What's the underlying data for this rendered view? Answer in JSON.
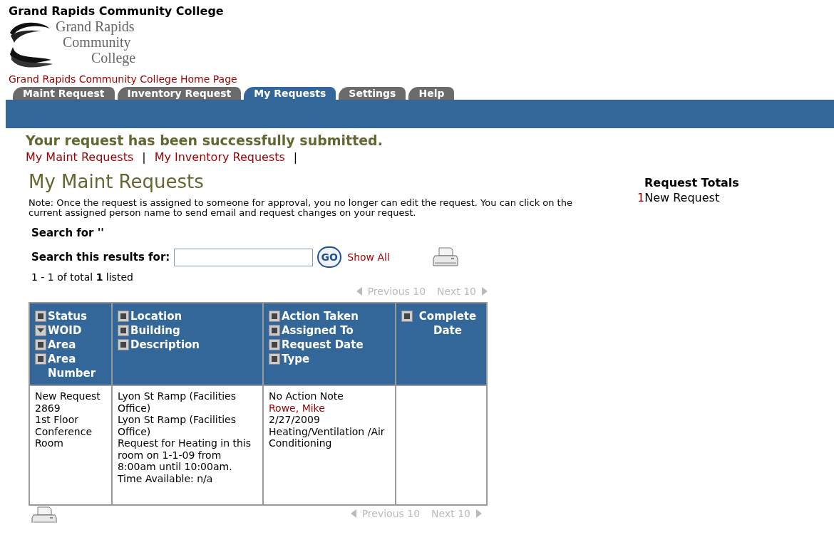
{
  "site_title": "Grand Rapids Community College",
  "logo_text": [
    "Grand Rapids",
    "Community",
    "College"
  ],
  "home_link": "Grand Rapids Community College Home Page",
  "tabs": [
    {
      "label": "Maint Request",
      "selected": false
    },
    {
      "label": "Inventory Request",
      "selected": false
    },
    {
      "label": "My Requests",
      "selected": true
    },
    {
      "label": "Settings",
      "selected": false
    },
    {
      "label": "Help",
      "selected": false
    }
  ],
  "success_message": "Your request has been successfully submitted.",
  "sub_links": [
    {
      "label": "My Maint Requests",
      "separator": "|"
    },
    {
      "label": "My Inventory Requests",
      "separator": "|"
    }
  ],
  "page_heading": "My Maint Requests",
  "note": "Note: Once the request is assigned to someone for approval, you no longer can edit the request. You can click on the current assigned person name to send email and request changes on your request.",
  "search_for": "Search for ''",
  "search_label": "Search this results for:",
  "go_button": "GO",
  "show_all": "Show All",
  "listed": "1 - 1 of total **1** listed",
  "pager_top": {
    "previous": "Previous 10",
    "next": "Next 10"
  },
  "pager_bottom": {
    "previous": "Previous 10",
    "next": "Next 10"
  },
  "table": {
    "columns": [
      {
        "fields": [
          {
            "label": "Status",
            "sorted": false
          },
          {
            "label": "WOID",
            "sorted": true
          },
          {
            "label": "Area",
            "sorted": false
          },
          {
            "label": "Area Number",
            "sorted": false
          }
        ]
      },
      {
        "fields": [
          {
            "label": "Location",
            "sorted": false
          },
          {
            "label": "Building",
            "sorted": false
          },
          {
            "label": "Description",
            "sorted": false
          }
        ]
      },
      {
        "fields": [
          {
            "label": "Action Taken",
            "sorted": false
          },
          {
            "label": "Assigned To",
            "sorted": false
          },
          {
            "label": "Request Date",
            "sorted": false
          },
          {
            "label": "Type",
            "sorted": false
          }
        ]
      },
      {
        "fields": [
          {
            "label": "Complete Date",
            "sorted": false
          }
        ]
      }
    ],
    "rows": [
      [
        [
          {
            "kind": "text",
            "text": "New Request"
          },
          {
            "kind": "text",
            "text": "2869"
          },
          {
            "kind": "text",
            "text": "1st Floor Conference Room"
          }
        ],
        [
          {
            "kind": "text",
            "text": "Lyon St Ramp (Facilities Office)"
          },
          {
            "kind": "text",
            "text": "Lyon St Ramp (Facilities Office)"
          },
          {
            "kind": "text",
            "text": "Request for Heating in this room on 1-1-09 from 8:00am until 10:00am. Time Available: n/a"
          }
        ],
        [
          {
            "kind": "text",
            "text": "No Action Note"
          },
          {
            "kind": "link",
            "text": "Rowe, Mike"
          },
          {
            "kind": "text",
            "text": "2/27/2009"
          },
          {
            "kind": "text",
            "text": "Heating/Ventilation /Air Conditioning"
          }
        ],
        []
      ]
    ]
  },
  "totals": {
    "title": "Request Totals",
    "items": [
      {
        "count": "1",
        "label": "New Request"
      }
    ]
  }
}
